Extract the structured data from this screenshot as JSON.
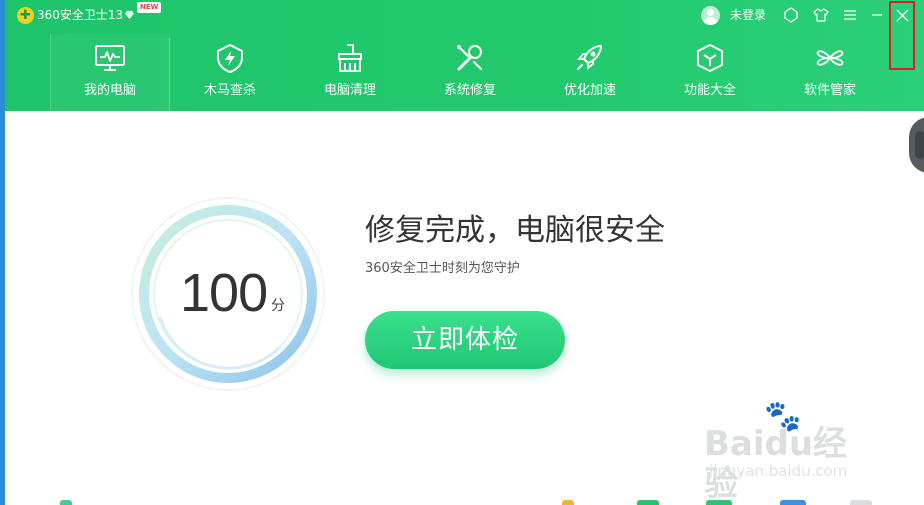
{
  "app": {
    "title": "360安全卫士13",
    "new_badge": "NEW",
    "login_text": "未登录"
  },
  "colors": {
    "header_green": "#22c96c",
    "accent_green": "#1fc774",
    "close_highlight": "#e21d24"
  },
  "nav": [
    {
      "label": "我的电脑",
      "icon": "monitor-icon",
      "active": true
    },
    {
      "label": "木马查杀",
      "icon": "shield-bolt-icon",
      "active": false
    },
    {
      "label": "电脑清理",
      "icon": "broom-icon",
      "active": false
    },
    {
      "label": "系统修复",
      "icon": "wrench-icon",
      "active": false
    },
    {
      "label": "优化加速",
      "icon": "rocket-icon",
      "active": false
    },
    {
      "label": "功能大全",
      "icon": "cube-icon",
      "active": false
    },
    {
      "label": "软件管家",
      "icon": "apps-icon",
      "active": false
    }
  ],
  "window_controls": [
    "skin-icon",
    "shirt-icon",
    "menu-icon",
    "minimize-icon",
    "close-icon"
  ],
  "score": {
    "value": "100",
    "unit": "分"
  },
  "status": {
    "title": "修复完成，电脑很安全",
    "subtitle": "360安全卫士时刻为您守护"
  },
  "actions": {
    "check_button": "立即体检"
  },
  "watermark": {
    "brand": "Baidu经验",
    "url": "jingyan.baidu.com"
  }
}
